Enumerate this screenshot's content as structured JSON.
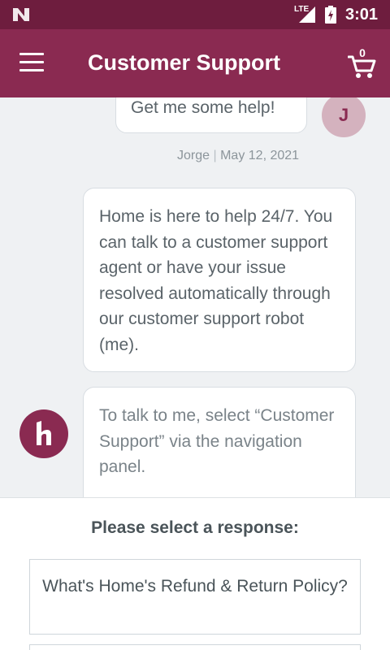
{
  "status_bar": {
    "time": "3:01",
    "network": "LTE",
    "icons": [
      "n-logo-icon",
      "signal-icon",
      "battery-charging-icon"
    ]
  },
  "app_bar": {
    "title": "Customer Support",
    "cart_count": "0",
    "background": "#8a2a51",
    "icons": [
      "menu-icon",
      "cart-icon"
    ]
  },
  "messages": [
    {
      "sender": "user",
      "text": "Get me some help!",
      "avatar_initial": "J",
      "author": "Jorge",
      "date": "May 12, 2021"
    },
    {
      "sender": "bot",
      "text": "Home is here to help 24/7. You can talk to a customer support agent or have your issue resolved automatically through our customer support robot (me)."
    },
    {
      "sender": "bot",
      "text": "To talk to me, select “Customer Support” via the navigation panel."
    }
  ],
  "meta_separator": "|",
  "response_panel": {
    "prompt": "Please select a response:",
    "options": [
      "What's Home's Refund & Return Policy?",
      ""
    ]
  },
  "colors": {
    "status_bar": "#6e1d3e",
    "brand": "#8a2a51",
    "chat_background": "#eff1f3"
  }
}
